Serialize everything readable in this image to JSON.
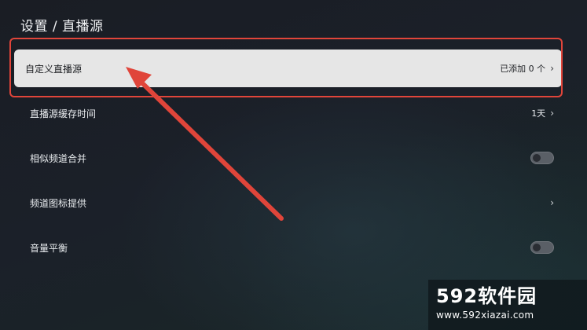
{
  "header": {
    "breadcrumb": "设置 / 直播源"
  },
  "settings": {
    "items": [
      {
        "label": "自定义直播源",
        "value": "已添加 0 个",
        "control": "chevron",
        "selected": true
      },
      {
        "label": "直播源缓存时间",
        "value": "1天",
        "control": "chevron",
        "selected": false
      },
      {
        "label": "相似频道合并",
        "value": "",
        "control": "toggle",
        "state": "off"
      },
      {
        "label": "频道图标提供",
        "value": "",
        "control": "chevron",
        "selected": false
      },
      {
        "label": "音量平衡",
        "value": "",
        "control": "toggle",
        "state": "off"
      }
    ]
  },
  "icons": {
    "chevron": "chevron-right-icon"
  },
  "colors": {
    "selected_bg": "#e6e6e6",
    "highlight": "#e0453a",
    "toggle_off": "#5a5f66"
  },
  "watermark": {
    "brand": "592软件园",
    "url": "www.592xiazai.com"
  }
}
